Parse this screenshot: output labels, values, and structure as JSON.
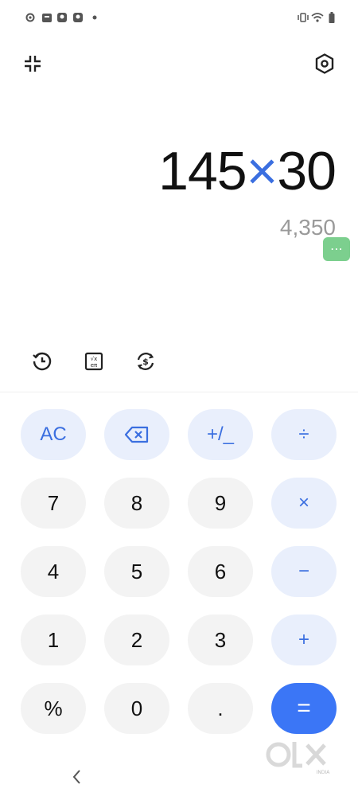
{
  "expression": {
    "left": "145",
    "operator": "×",
    "right": "30"
  },
  "result": "4,350",
  "more_chip": "⋯",
  "keys": {
    "ac": "AC",
    "plusminus": "+/_",
    "divide": "÷",
    "seven": "7",
    "eight": "8",
    "nine": "9",
    "multiply": "×",
    "four": "4",
    "five": "5",
    "six": "6",
    "minus": "−",
    "one": "1",
    "two": "2",
    "three": "3",
    "plus": "+",
    "percent": "%",
    "zero": "0",
    "dot": ".",
    "equals": "="
  },
  "watermark": {
    "brand": "OLX",
    "sub": "INDIA"
  },
  "colors": {
    "accent": "#3b6fe0",
    "equals_bg": "#3b76f6",
    "fn_key_bg": "#e9effc",
    "num_key_bg": "#f3f3f3"
  },
  "icons": {
    "minimize": "minimize-icon",
    "settings": "settings-hex-icon",
    "history": "history-icon",
    "scientific": "scientific-functions-icon",
    "currency": "currency-convert-icon",
    "backspace": "backspace-icon",
    "back": "back-chevron-icon"
  }
}
